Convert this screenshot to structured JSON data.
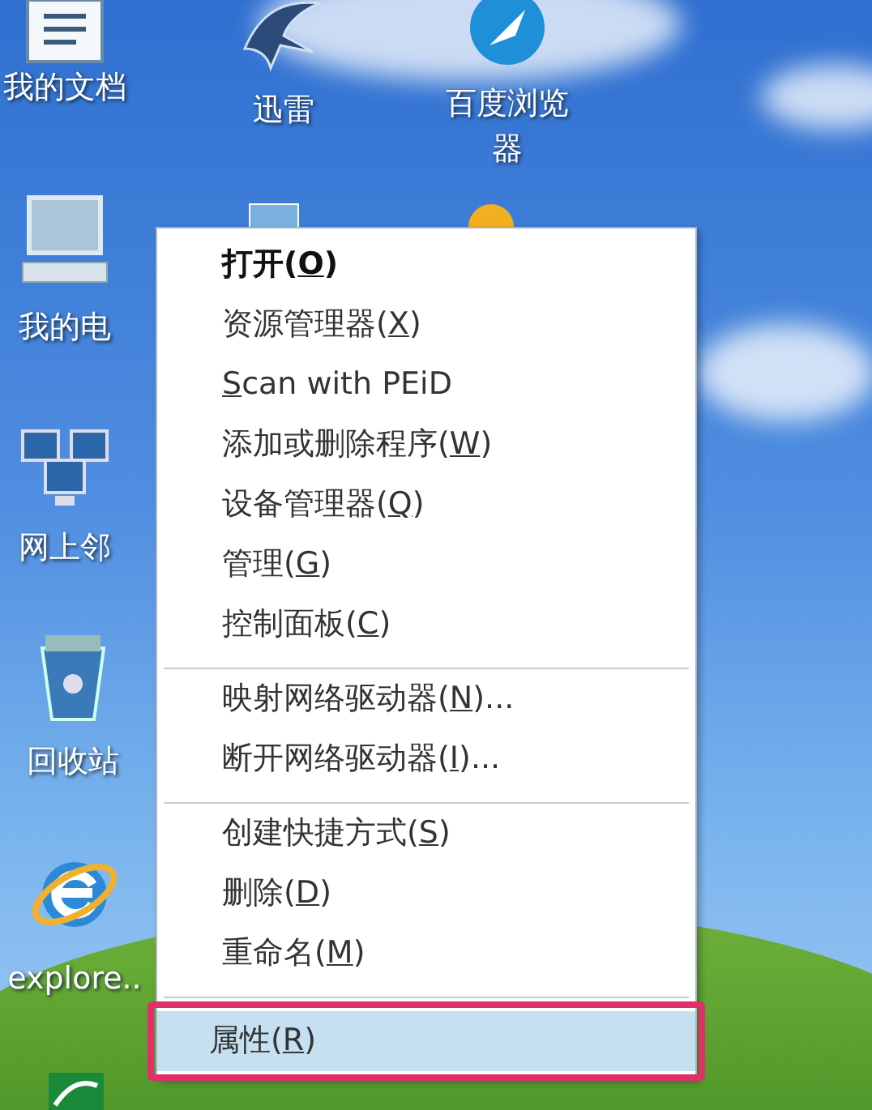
{
  "desktop_icons": [
    {
      "kind": "document",
      "label": "我的文档"
    },
    {
      "kind": "bird",
      "label": "迅雷"
    },
    {
      "kind": "browser",
      "label": "百度浏览器"
    },
    {
      "kind": "computer",
      "label": "我的电"
    },
    {
      "kind": "network",
      "label": "网上邻"
    },
    {
      "kind": "recycle",
      "label": "回收站"
    },
    {
      "kind": "ie",
      "label": "explore.."
    }
  ],
  "context_menu": {
    "groups": [
      [
        {
          "before": "打开(",
          "access_key": "O",
          "after": ")",
          "default": true,
          "selected": false
        },
        {
          "before": "资源管理器(",
          "access_key": "X",
          "after": ")",
          "default": false,
          "selected": false
        },
        {
          "access_key": "S",
          "after": "can with PEiD",
          "default": false,
          "selected": false
        },
        {
          "before": "添加或删除程序(",
          "access_key": "W",
          "after": ")",
          "default": false,
          "selected": false
        },
        {
          "before": "设备管理器(",
          "access_key": "Q",
          "after": ")",
          "default": false,
          "selected": false
        },
        {
          "before": "管理(",
          "access_key": "G",
          "after": ")",
          "default": false,
          "selected": false
        },
        {
          "before": "控制面板(",
          "access_key": "C",
          "after": ")",
          "default": false,
          "selected": false
        }
      ],
      [
        {
          "before": "映射网络驱动器(",
          "access_key": "N",
          "after": ")...",
          "default": false,
          "selected": false
        },
        {
          "before": "断开网络驱动器(",
          "access_key": "I",
          "after": ")...",
          "default": false,
          "selected": false
        }
      ],
      [
        {
          "before": "创建快捷方式(",
          "access_key": "S",
          "after": ")",
          "default": false,
          "selected": false
        },
        {
          "before": "删除(",
          "access_key": "D",
          "after": ")",
          "default": false,
          "selected": false
        },
        {
          "before": "重命名(",
          "access_key": "M",
          "after": ")",
          "default": false,
          "selected": false
        }
      ],
      [
        {
          "before": "属性(",
          "access_key": "R",
          "after": ")",
          "default": false,
          "selected": true
        }
      ]
    ]
  }
}
